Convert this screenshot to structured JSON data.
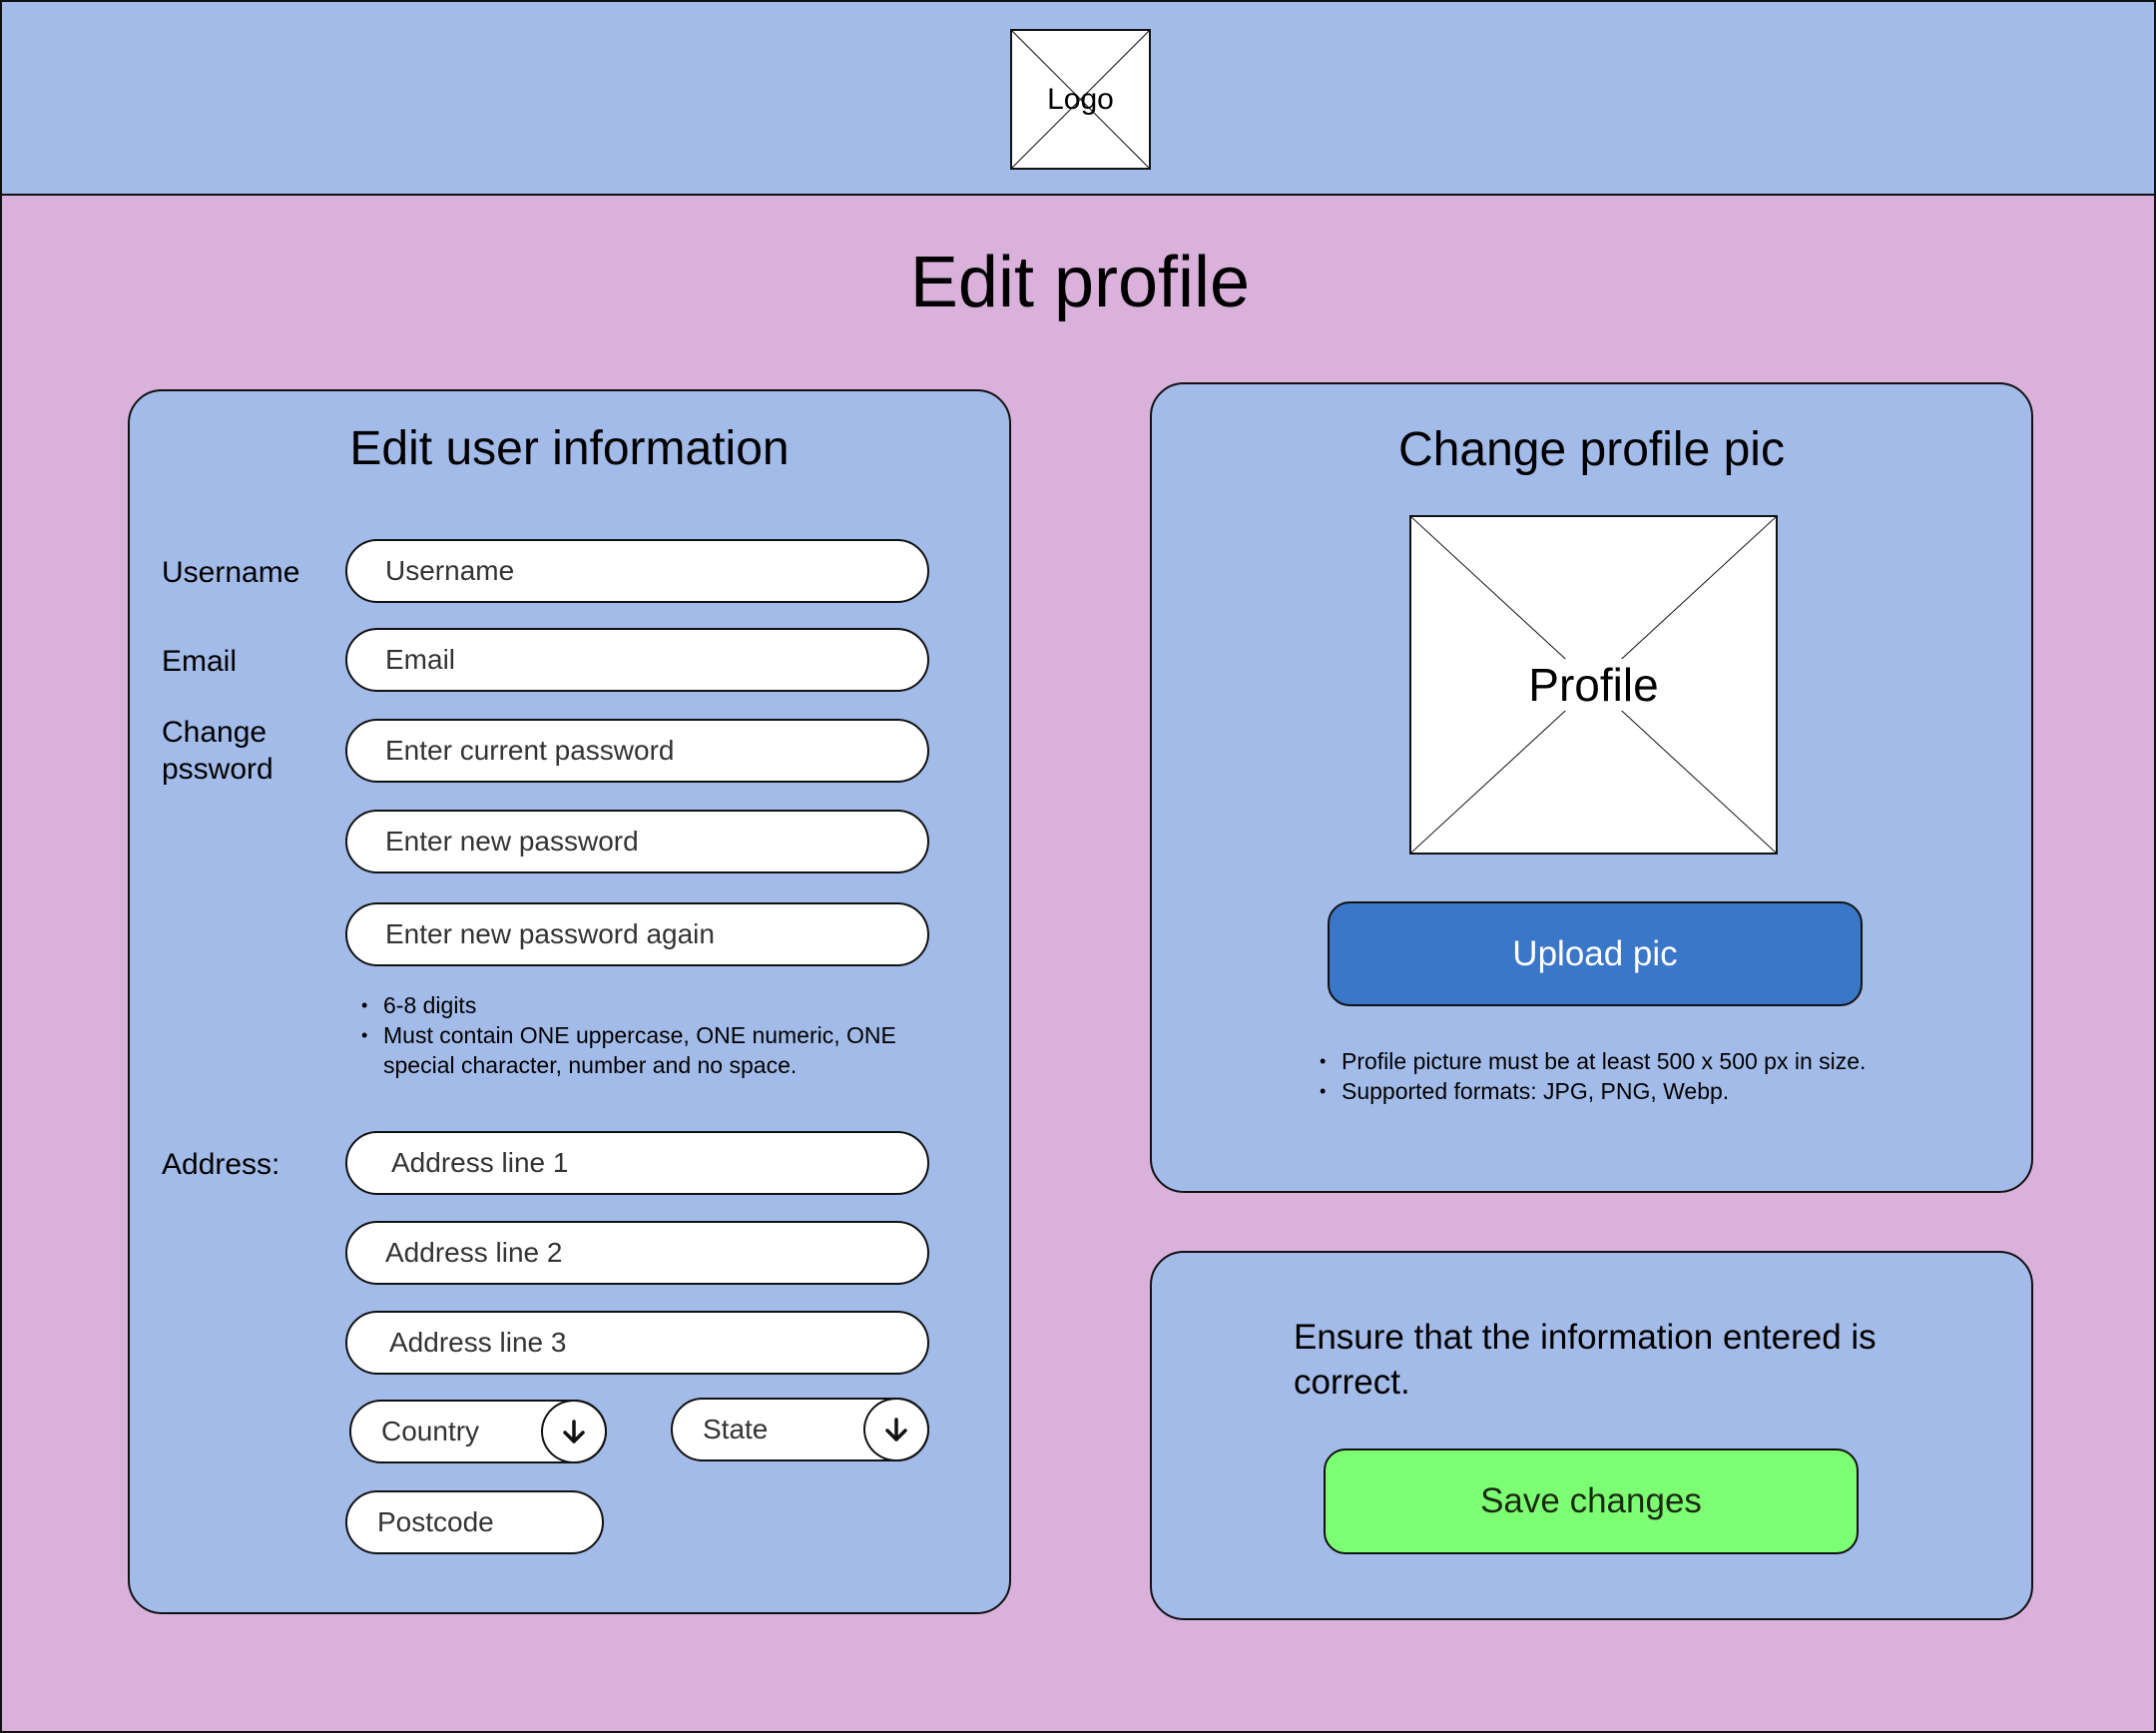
{
  "header": {
    "logo_label": "Logo"
  },
  "page_title": "Edit profile",
  "user_info": {
    "title": "Edit user information",
    "username": {
      "label": "Username",
      "placeholder": "Username"
    },
    "email": {
      "label": "Email",
      "placeholder": "Email"
    },
    "password": {
      "label": "Change pssword",
      "current_placeholder": "Enter current password",
      "new_placeholder": "Enter new password",
      "confirm_placeholder": "Enter new password again",
      "rules": [
        "6-8 digits",
        "Must contain ONE uppercase, ONE numeric, ONE special character, number and no space."
      ]
    },
    "address": {
      "label": "Address:",
      "line1": "Address line 1",
      "line2": "Address line 2",
      "line3": "Address line 3",
      "country": "Country",
      "state": "State",
      "postcode": "Postcode"
    }
  },
  "profile_pic": {
    "title": "Change profile pic",
    "placeholder_label": "Profile",
    "upload_label": "Upload pic",
    "rules": [
      "Profile picture must be at least 500 x 500 px in size.",
      "Supported formats: JPG, PNG, Webp."
    ]
  },
  "save": {
    "note": "Ensure that the information entered is correct.",
    "button_label": "Save changes"
  },
  "colors": {
    "background": "#d9b1db",
    "panel": "#a3bbe8",
    "upload_button": "#3b77c8",
    "save_button": "#7dff74"
  }
}
